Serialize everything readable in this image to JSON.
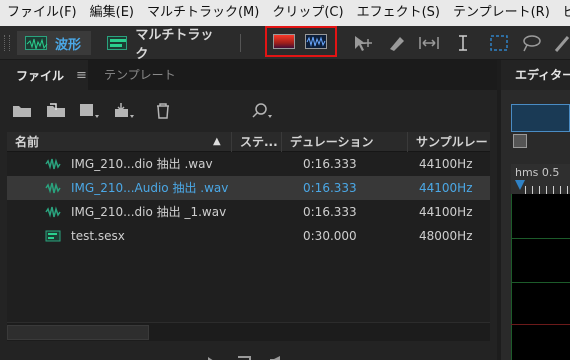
{
  "menu": [
    "ファイル(F)",
    "編集(E)",
    "マルチトラック(M)",
    "クリップ(C)",
    "エフェクト(S)",
    "テンプレート(R)",
    "ビュー"
  ],
  "toolbar": {
    "waveform_label": "波形",
    "multitrack_label": "マルチトラック"
  },
  "files_panel": {
    "tab_files": "ファイル",
    "tab_menu_glyph": "≡",
    "tab_templates": "テンプレート",
    "search_placeholder": "",
    "columns": {
      "name": "名前",
      "status": "ステ...",
      "duration": "デュレーション",
      "sample_rate": "サンプルレート"
    },
    "rows": [
      {
        "name": "IMG_210...dio 抽出 .wav",
        "duration": "0:16.333",
        "sample_rate": "44100Hz",
        "type": "audio",
        "selected": false
      },
      {
        "name": "IMG_210...Audio 抽出 .wav",
        "duration": "0:16.333",
        "sample_rate": "44100Hz",
        "type": "audio",
        "selected": true
      },
      {
        "name": "IMG_210...dio 抽出 _1.wav",
        "duration": "0:16.333",
        "sample_rate": "44100Hz",
        "type": "audio",
        "selected": false
      },
      {
        "name": "test.sesx",
        "duration": "0:30.000",
        "sample_rate": "48000Hz",
        "type": "session",
        "selected": false
      }
    ]
  },
  "editor_panel": {
    "tab_label": "エディター",
    "ruler_label": "hms",
    "ruler_value": "0.5"
  },
  "colors": {
    "accent": "#4ba8e6",
    "audio_icon": "#2aa37e",
    "highlight_box": "#e21414"
  }
}
